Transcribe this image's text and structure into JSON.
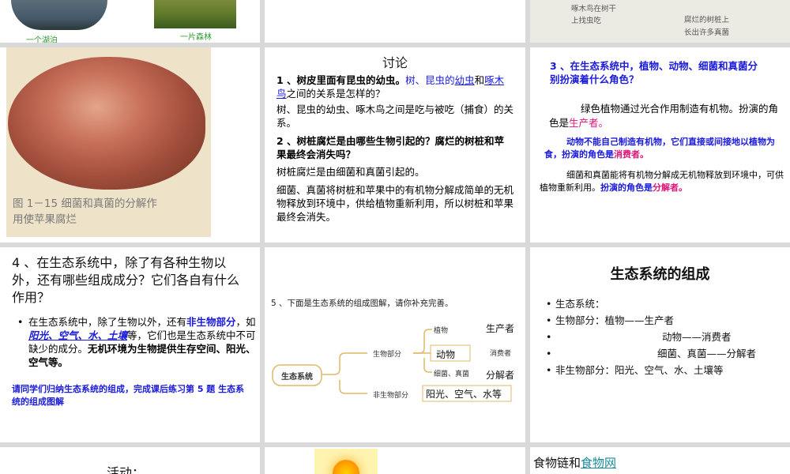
{
  "top": {
    "lake_caption": "一个湖泊",
    "forest_caption": "一片森林",
    "bird_caption": [
      "啄木鸟在树干",
      "上找虫吃"
    ],
    "stump_caption": [
      "腐烂的树桩上",
      "长出许多真菌"
    ]
  },
  "apple": {
    "caption_line1": "图 1－15  细菌和真菌的分解作",
    "caption_line2": "用使苹果腐烂"
  },
  "discuss": {
    "title": "讨论",
    "q1_a": "1 、树皮里面有昆虫的幼虫。",
    "q1_b": "树、昆虫的",
    "q1_c": "幼虫",
    "q1_d": "和",
    "q1_e": "啄木鸟",
    "q1_f": "之间的关系是怎样的？",
    "a1": "树、昆虫的幼虫、啄木鸟之间是吃与被吃（捕食）的关系。",
    "q2": "2 、树桩腐烂是由哪些生物引起的？腐烂的树桩和苹果最终会消失吗？",
    "a2_1": "树桩腐烂是由细菌和真菌引起的。",
    "a2_2": "细菌、真菌将树桩和苹果中的有机物分解成简单的无机物释放到环境中，供给植物重新利用，所以树桩和苹果最终会消失。"
  },
  "roles": {
    "q3": "3 、在生态系统中，植物、动物、细菌和真菌分别扮演着什么角色？",
    "plant": "绿色植物通过光合作用制造有机物。扮演的角色是",
    "producer": "生产者。",
    "animal": "动物不能自己制造有机物，它们直接或间接地以植物为食，扮演的角色是",
    "consumer": "消费者。",
    "fungi": "细菌和真菌能将有机物分解成无机物释放到环境中，可供植物重新利用。",
    "fungi_role": "扮演的角色是",
    "decomposer": "分解者。"
  },
  "q4": {
    "title": "4 、在生态系统中，除了有各种生物以外，还有哪些组成成分？它们各自有什么作用？",
    "b_1": "在生态系统中，除了生物以外，还有",
    "b_2": "非生物部分",
    "b_3": "，如",
    "b_4": "阳光、空气、水、土壤",
    "b_5": "等，它们也是生态系统中不可缺少的成分。",
    "b_6": "无机环境为生物提供生存空间、阳光、空气等。",
    "note": "请同学们归纳生态系统的组成，完成课后练习第 5 题 生态系统的组成图解"
  },
  "diagram": {
    "prompt": "5 、下面是生态系统的组成图解，请你补充完善。",
    "root": "生态系统",
    "bio": "生物部分",
    "nonbio": "非生物部分",
    "plant": "植物",
    "animal": "动物",
    "fungi": "细菌、真菌",
    "producer": "生产者",
    "consumer": "消费者",
    "decomposer": "分解者",
    "nonbio_items": "阳光、空气、水等"
  },
  "composition": {
    "title": "生态系统的组成",
    "items": [
      "生态系统：",
      "生物部分：植物——生产者",
      "动物——消费者",
      "细菌、真菌——分解者",
      "非生物部分：阳光、空气、水、土壤等"
    ]
  },
  "bottom": {
    "activity": "活动：",
    "food_chain": "食物链和",
    "food_web": "食物网"
  }
}
